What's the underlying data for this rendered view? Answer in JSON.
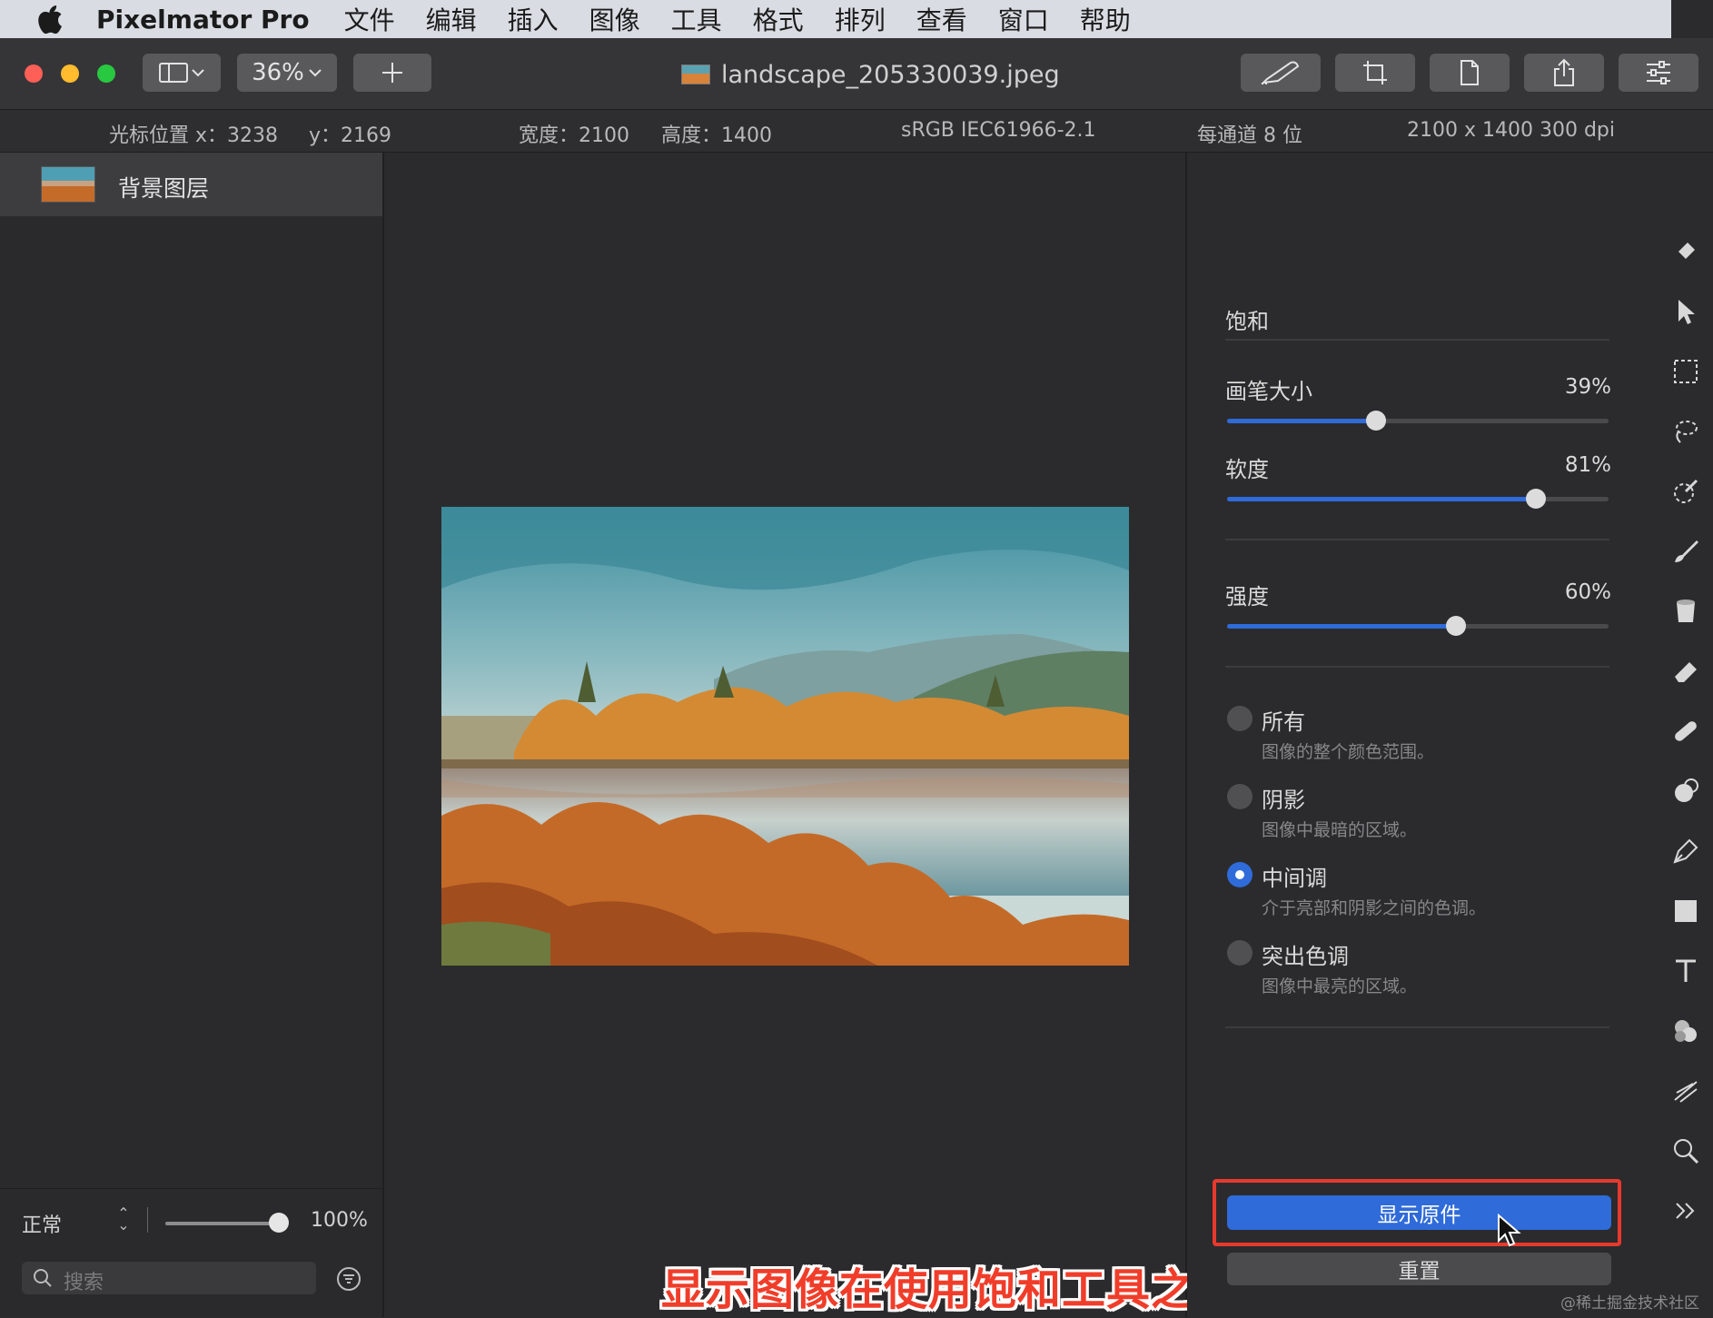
{
  "menubar": {
    "app_name": "Pixelmator Pro",
    "items": [
      "文件",
      "编辑",
      "插入",
      "图像",
      "工具",
      "格式",
      "排列",
      "查看",
      "窗口",
      "帮助"
    ]
  },
  "toolbar": {
    "zoom_label": "36%",
    "document_title": "landscape_205330039.jpeg"
  },
  "infobar": {
    "cursor_x": "光标位置 x：3238",
    "cursor_y": "y：2169",
    "width": "宽度：2100",
    "height": "高度：1400",
    "color_profile": "sRGB IEC61966-2.1",
    "bit_depth": "每通道 8 位",
    "size_dpi": "2100 x 1400 300 dpi"
  },
  "layers": {
    "items": [
      {
        "name": "背景图层"
      }
    ],
    "blend_mode": "正常",
    "opacity": "100%",
    "opacity_fraction": 1.0,
    "search_placeholder": "搜索"
  },
  "canvas": {
    "caption": "显示图像在使用饱和工具之前的样子，单击「显示原件」"
  },
  "saturation_panel": {
    "title": "饱和",
    "sliders": [
      {
        "label": "画笔大小",
        "value": "39%",
        "fraction": 0.39
      },
      {
        "label": "软度",
        "value": "81%",
        "fraction": 0.81
      },
      {
        "label": "强度",
        "value": "60%",
        "fraction": 0.6
      }
    ],
    "ranges": [
      {
        "label": "所有",
        "desc": "图像的整个颜色范围。",
        "selected": false
      },
      {
        "label": "阴影",
        "desc": "图像中最暗的区域。",
        "selected": false
      },
      {
        "label": "中间调",
        "desc": "介于亮部和阴影之间的色调。",
        "selected": true
      },
      {
        "label": "突出色调",
        "desc": "图像中最亮的区域。",
        "selected": false
      }
    ],
    "show_original_label": "显示原件",
    "reset_label": "重置"
  },
  "tools": [
    "brush-arrange-icon",
    "pointer-icon",
    "rect-select-icon",
    "lasso-icon",
    "color-picker-icon",
    "paint-brush-icon",
    "fill-bucket-icon",
    "eraser-icon",
    "bandage-icon",
    "repair-icon",
    "pen-icon",
    "shape-icon",
    "text-icon",
    "color-adjust-icon",
    "distort-icon",
    "zoom-icon",
    "more-icon"
  ],
  "watermark": "@稀土掘金技术社区",
  "colors": {
    "accent": "#2f6bd9",
    "highlight_box": "#e8392d",
    "caption": "#f03d2a"
  }
}
